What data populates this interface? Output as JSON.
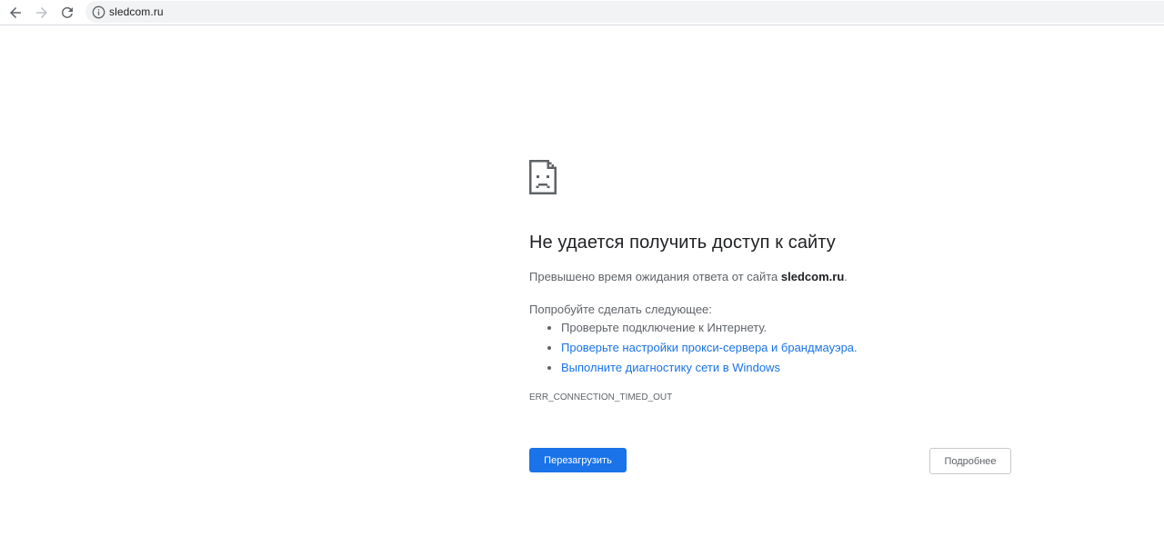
{
  "toolbar": {
    "back_icon": "arrow-left-icon",
    "forward_icon": "arrow-right-icon",
    "reload_icon": "reload-icon",
    "info_icon": "info-circle-icon",
    "url": "sledcom.ru"
  },
  "error": {
    "icon": "sad-page-icon",
    "heading": "Не удается получить доступ к сайту",
    "summary_prefix": "Превышено время ожидания ответа от сайта ",
    "summary_host": "sledcom.ru",
    "summary_suffix": ".",
    "suggestions_title": "Попробуйте сделать следующее:",
    "suggestions": [
      {
        "text": "Проверьте подключение к Интернету."
      },
      {
        "text": "Проверьте настройки прокси-сервера и брандмауэра."
      },
      {
        "text": "Выполните диагностику сети в Windows"
      }
    ],
    "code": "ERR_CONNECTION_TIMED_OUT",
    "reload_label": "Перезагрузить",
    "details_label": "Подробнее"
  },
  "colors": {
    "accent": "#1a73e8",
    "text_primary": "#202124",
    "text_secondary": "#5f6368",
    "omnibox_bg": "#f1f3f4"
  }
}
